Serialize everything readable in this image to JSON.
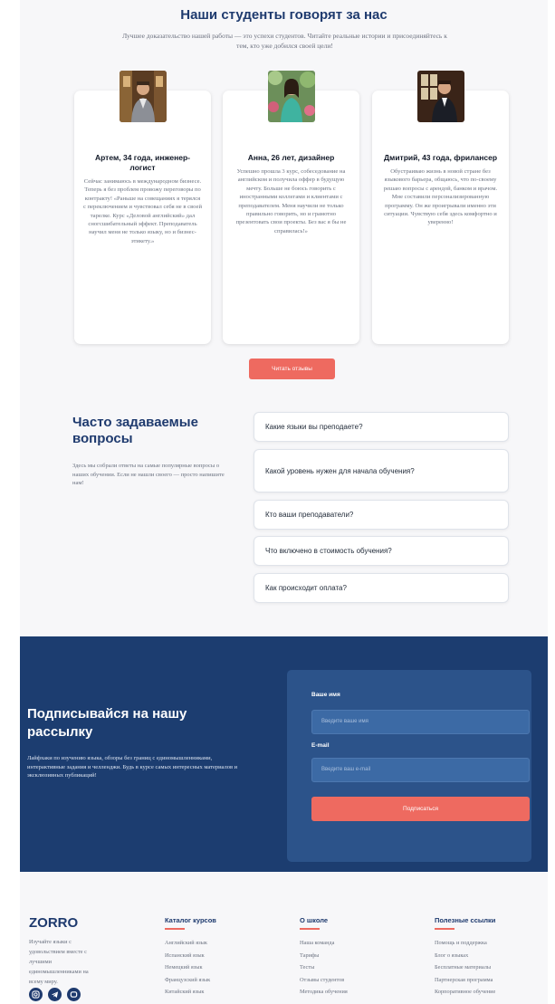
{
  "testimonials": {
    "title": "Наши студенты говорят за нас",
    "subtitle": "Лучшее доказательство нашей работы — это успехи студентов. Читайте реальные истории и присоединяйтесь к тем, кто уже добился своей цели!",
    "cards": [
      {
        "name": "Артем, 34 года, инженер-логист",
        "text": "Сейчас занимаюсь в международном бизнесе. Теперь я без проблем провожу переговоры по контракту! «Раньше на совещаниях я терялся с переключением и чувствовал себя не в своей тарелке. Курс «Деловой английский» дал сногсшибательный эффект. Преподаватель научил меня не только языку, но и бизнес-этикету.»",
        "photo_icon": "student-photo-artem"
      },
      {
        "name": "Анна, 26 лет, дизайнер",
        "text": "Успешно прошла 3 курс, собеседование на английском и получила оффер в будущую мечту. Больше не боюсь говорить с иностранными коллегами и клиентами с преподавателем. Меня научили не только правильно говорить, но и грамотно презентовать свои проекты. Без вас я бы не справилась!»",
        "photo_icon": "student-photo-anna"
      },
      {
        "name": "Дмитрий, 43 года, фрилансер",
        "text": "Обустраиваю жизнь в новой стране без языкового барьера, общаюсь, что по-своему решаю вопросы с арендой, банком и врачом. Мне составили персонализированную программу. Он же проигрывали именно эти ситуации. Чувствую себя здесь комфортно и уверенно!",
        "photo_icon": "student-photo-dmitry"
      }
    ],
    "more_button": "Читать отзывы"
  },
  "faq": {
    "title": "Часто задаваемые вопросы",
    "text": "Здесь мы собрали ответы на самые популярные вопросы о наших обучении. Если не нашли своего — просто напишите нам!",
    "items": [
      "Какие языки вы преподаете?",
      "Какой уровень нужен для начала обучения?",
      "Кто ваши преподаватели?",
      "Что включено в стоимость обучения?",
      "Как происходит оплата?"
    ]
  },
  "newsletter": {
    "title": "Подписывайся на нашу рассылку",
    "text": "Лайфхаки по изучению языка, обзоры без границ с единомышленниками, интерактивные задания и челленджи. Будь в курсе самых интересных материалов и эксклюзивных публикаций!",
    "name_label": "Ваше имя",
    "name_placeholder": "Введите ваше имя",
    "email_label": "E-mail",
    "email_placeholder": "Введите ваш e-mail",
    "submit": "Подписаться"
  },
  "footer": {
    "logo": "ZORRO",
    "logo_text": "Изучайте языки с удовольствием вместе с лучшими единомышленниками на всему миру.",
    "socials": [
      "instagram-icon",
      "telegram-icon",
      "vk-icon"
    ],
    "columns": [
      {
        "title": "Каталог курсов",
        "items": [
          "Английский язык",
          "Испанский язык",
          "Немецкий язык",
          "Французский язык",
          "Китайский язык"
        ]
      },
      {
        "title": "О школе",
        "items": [
          "Наша команда",
          "Тарифы",
          "Тесты",
          "Отзывы студентов",
          "Методика обучения"
        ]
      },
      {
        "title": "Полезные ссылки",
        "items": [
          "Помощь и поддержка",
          "Блог о языках",
          "Бесплатные материалы",
          "Партнерская программа",
          "Корпоративное обучение"
        ]
      }
    ]
  },
  "colors": {
    "primary": "#1e3a6e",
    "accent": "#ee6a60",
    "newsletter_bg": "#1c3d70"
  }
}
